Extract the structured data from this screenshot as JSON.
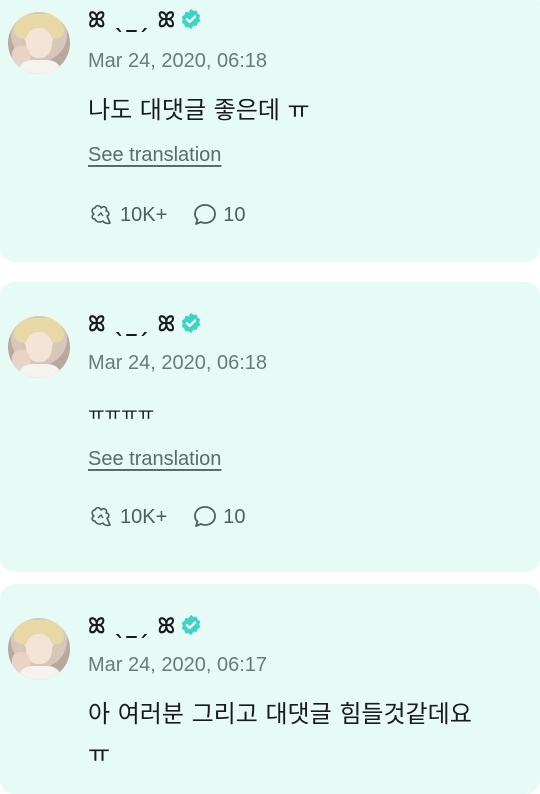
{
  "posts": [
    {
      "author": "ꕤ ˎ_ˏ ꕤ",
      "date": "Mar 24, 2020, 06:18",
      "text": "나도 대댓글 좋은데 ㅠ",
      "translate_label": "See translation",
      "likes": "10K+",
      "comments": "10"
    },
    {
      "author": "ꕤ ˎ_ˏ ꕤ",
      "date": "Mar 24, 2020, 06:18",
      "text": "ㅠㅠㅠㅠ",
      "translate_label": "See translation",
      "likes": "10K+",
      "comments": "10"
    },
    {
      "author": "ꕤ ˎ_ˏ ꕤ",
      "date": "Mar 24, 2020, 06:17",
      "text": "아 여러분 그리고 대댓글 힘들것같데요",
      "text_line2": "ㅠ"
    }
  ],
  "colors": {
    "card_bg": "#e6fbf6",
    "verified": "#3fd3c8"
  },
  "icons": [
    "verified-badge-icon",
    "like-icon",
    "comment-icon"
  ]
}
